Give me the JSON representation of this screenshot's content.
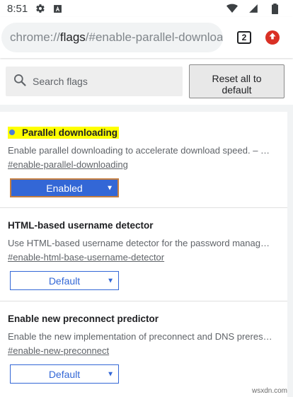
{
  "status_bar": {
    "time": "8:51",
    "icons": [
      "gear-icon",
      "text-icon",
      "wifi-icon",
      "signal-icon",
      "battery-icon"
    ]
  },
  "toolbar": {
    "url_scheme": "chrome://",
    "url_host": "flags",
    "url_path": "/#enable-parallel-downloading",
    "tab_count": "2",
    "update_icon": "up-arrow-icon",
    "update_color": "#d93025"
  },
  "search": {
    "placeholder": "Search flags",
    "reset_line1": "Reset all to",
    "reset_line2": "default"
  },
  "experiments": [
    {
      "title": "Parallel downloading",
      "highlighted": true,
      "description": "Enable parallel downloading to accelerate download speed. – …",
      "permalink": "#enable-parallel-downloading",
      "selected": "Enabled"
    },
    {
      "title": "HTML-based username detector",
      "highlighted": false,
      "description": "Use HTML-based username detector for the password manag…",
      "permalink": "#enable-html-base-username-detector",
      "selected": "Default"
    },
    {
      "title": "Enable new preconnect predictor",
      "highlighted": false,
      "description": "Enable the new implementation of preconnect and DNS preres…",
      "permalink": "#enable-new-preconnect",
      "selected": "Default"
    }
  ],
  "watermark": "wsxdn.com",
  "colors": {
    "accent": "#3367d6",
    "highlight": "#ffff00",
    "modified_dot": "#4a7ed9"
  }
}
